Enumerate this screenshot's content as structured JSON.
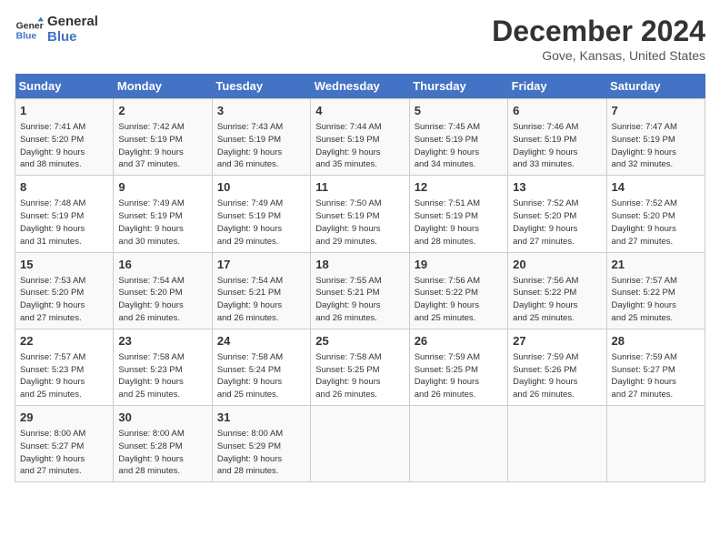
{
  "logo": {
    "line1": "General",
    "line2": "Blue"
  },
  "title": "December 2024",
  "subtitle": "Gove, Kansas, United States",
  "weekdays": [
    "Sunday",
    "Monday",
    "Tuesday",
    "Wednesday",
    "Thursday",
    "Friday",
    "Saturday"
  ],
  "weeks": [
    [
      {
        "day": "1",
        "info": "Sunrise: 7:41 AM\nSunset: 5:20 PM\nDaylight: 9 hours\nand 38 minutes."
      },
      {
        "day": "2",
        "info": "Sunrise: 7:42 AM\nSunset: 5:19 PM\nDaylight: 9 hours\nand 37 minutes."
      },
      {
        "day": "3",
        "info": "Sunrise: 7:43 AM\nSunset: 5:19 PM\nDaylight: 9 hours\nand 36 minutes."
      },
      {
        "day": "4",
        "info": "Sunrise: 7:44 AM\nSunset: 5:19 PM\nDaylight: 9 hours\nand 35 minutes."
      },
      {
        "day": "5",
        "info": "Sunrise: 7:45 AM\nSunset: 5:19 PM\nDaylight: 9 hours\nand 34 minutes."
      },
      {
        "day": "6",
        "info": "Sunrise: 7:46 AM\nSunset: 5:19 PM\nDaylight: 9 hours\nand 33 minutes."
      },
      {
        "day": "7",
        "info": "Sunrise: 7:47 AM\nSunset: 5:19 PM\nDaylight: 9 hours\nand 32 minutes."
      }
    ],
    [
      {
        "day": "8",
        "info": "Sunrise: 7:48 AM\nSunset: 5:19 PM\nDaylight: 9 hours\nand 31 minutes."
      },
      {
        "day": "9",
        "info": "Sunrise: 7:49 AM\nSunset: 5:19 PM\nDaylight: 9 hours\nand 30 minutes."
      },
      {
        "day": "10",
        "info": "Sunrise: 7:49 AM\nSunset: 5:19 PM\nDaylight: 9 hours\nand 29 minutes."
      },
      {
        "day": "11",
        "info": "Sunrise: 7:50 AM\nSunset: 5:19 PM\nDaylight: 9 hours\nand 29 minutes."
      },
      {
        "day": "12",
        "info": "Sunrise: 7:51 AM\nSunset: 5:19 PM\nDaylight: 9 hours\nand 28 minutes."
      },
      {
        "day": "13",
        "info": "Sunrise: 7:52 AM\nSunset: 5:20 PM\nDaylight: 9 hours\nand 27 minutes."
      },
      {
        "day": "14",
        "info": "Sunrise: 7:52 AM\nSunset: 5:20 PM\nDaylight: 9 hours\nand 27 minutes."
      }
    ],
    [
      {
        "day": "15",
        "info": "Sunrise: 7:53 AM\nSunset: 5:20 PM\nDaylight: 9 hours\nand 27 minutes."
      },
      {
        "day": "16",
        "info": "Sunrise: 7:54 AM\nSunset: 5:20 PM\nDaylight: 9 hours\nand 26 minutes."
      },
      {
        "day": "17",
        "info": "Sunrise: 7:54 AM\nSunset: 5:21 PM\nDaylight: 9 hours\nand 26 minutes."
      },
      {
        "day": "18",
        "info": "Sunrise: 7:55 AM\nSunset: 5:21 PM\nDaylight: 9 hours\nand 26 minutes."
      },
      {
        "day": "19",
        "info": "Sunrise: 7:56 AM\nSunset: 5:22 PM\nDaylight: 9 hours\nand 25 minutes."
      },
      {
        "day": "20",
        "info": "Sunrise: 7:56 AM\nSunset: 5:22 PM\nDaylight: 9 hours\nand 25 minutes."
      },
      {
        "day": "21",
        "info": "Sunrise: 7:57 AM\nSunset: 5:22 PM\nDaylight: 9 hours\nand 25 minutes."
      }
    ],
    [
      {
        "day": "22",
        "info": "Sunrise: 7:57 AM\nSunset: 5:23 PM\nDaylight: 9 hours\nand 25 minutes."
      },
      {
        "day": "23",
        "info": "Sunrise: 7:58 AM\nSunset: 5:23 PM\nDaylight: 9 hours\nand 25 minutes."
      },
      {
        "day": "24",
        "info": "Sunrise: 7:58 AM\nSunset: 5:24 PM\nDaylight: 9 hours\nand 25 minutes."
      },
      {
        "day": "25",
        "info": "Sunrise: 7:58 AM\nSunset: 5:25 PM\nDaylight: 9 hours\nand 26 minutes."
      },
      {
        "day": "26",
        "info": "Sunrise: 7:59 AM\nSunset: 5:25 PM\nDaylight: 9 hours\nand 26 minutes."
      },
      {
        "day": "27",
        "info": "Sunrise: 7:59 AM\nSunset: 5:26 PM\nDaylight: 9 hours\nand 26 minutes."
      },
      {
        "day": "28",
        "info": "Sunrise: 7:59 AM\nSunset: 5:27 PM\nDaylight: 9 hours\nand 27 minutes."
      }
    ],
    [
      {
        "day": "29",
        "info": "Sunrise: 8:00 AM\nSunset: 5:27 PM\nDaylight: 9 hours\nand 27 minutes."
      },
      {
        "day": "30",
        "info": "Sunrise: 8:00 AM\nSunset: 5:28 PM\nDaylight: 9 hours\nand 28 minutes."
      },
      {
        "day": "31",
        "info": "Sunrise: 8:00 AM\nSunset: 5:29 PM\nDaylight: 9 hours\nand 28 minutes."
      },
      {
        "day": "",
        "info": ""
      },
      {
        "day": "",
        "info": ""
      },
      {
        "day": "",
        "info": ""
      },
      {
        "day": "",
        "info": ""
      }
    ]
  ]
}
